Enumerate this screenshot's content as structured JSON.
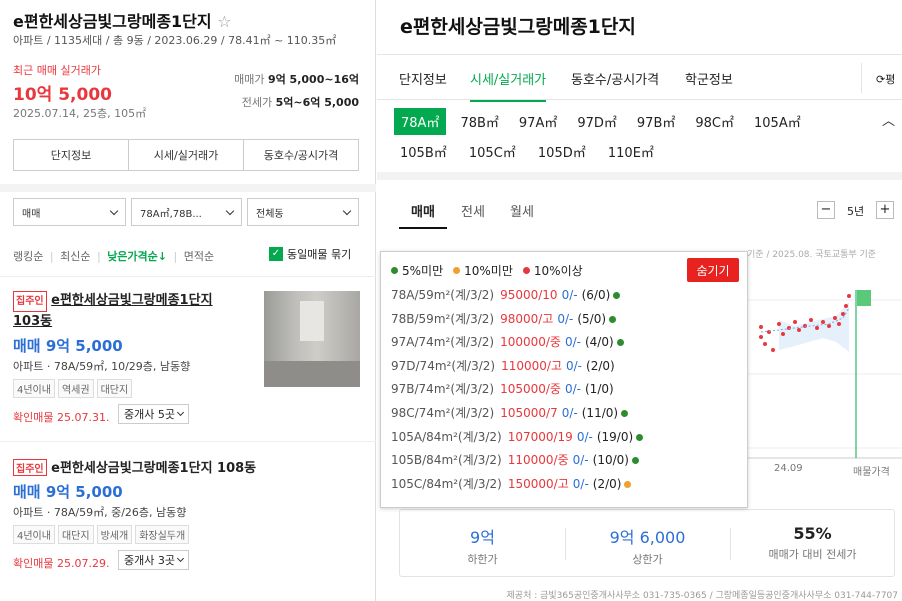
{
  "left": {
    "complex_name": "e편한세상금빛그랑메종1단지",
    "complex_info": "아파트 / 1135세대 / 총 9동 / 2023.06.29 / 78.41㎡ ~ 110.35㎡",
    "recent_label": "최근 매매 실거래가",
    "recent_price": "10억 5,000",
    "recent_date": "2025.07.14, 25층, 105㎡",
    "sale_label": "매매가",
    "sale_range": "9억 5,000~16억",
    "jeonse_label": "전세가",
    "jeonse_range": "5억~6억 5,000",
    "tabs": [
      "단지정보",
      "시세/실거래가",
      "동호수/공시가격"
    ],
    "filters": [
      "매매",
      "78A㎡,78B...",
      "전체동"
    ],
    "sort": [
      "랭킹순",
      "최신순",
      "낮은가격순↓",
      "면적순"
    ],
    "group_label": "동일매물 묶기",
    "listings": [
      {
        "badge": "집주인",
        "title": "e편한세상금빛그랑메종1단지 103동",
        "title_line1": "e편한세상금빛그랑메종1단지",
        "title_line2": "103동",
        "price": "매매 9억 5,000",
        "detail": "아파트 · 78A/59㎡, 10/29층, 남동향",
        "chips": [
          "4년이내",
          "역세권",
          "대단지"
        ],
        "confirm": "확인매물 25.07.31.",
        "agent": "중개사 5곳"
      },
      {
        "badge": "집주인",
        "title": "e편한세상금빛그랑메종1단지 108동",
        "price": "매매 9억 5,000",
        "detail": "아파트 · 78A/59㎡, 중/26층, 남동향",
        "chips": [
          "4년이내",
          "대단지",
          "방세개",
          "화장실두개"
        ],
        "confirm": "확인매물 25.07.29.",
        "agent": "중개사 3곳"
      }
    ]
  },
  "right": {
    "title": "e편한세상금빛그랑메종1단지",
    "tabs": [
      "단지정보",
      "시세/실거래가",
      "동호수/공시가격",
      "학군정보"
    ],
    "refresh_label": "평",
    "area_chips_row1": [
      "78A㎡",
      "78B㎡",
      "97A㎡",
      "97D㎡",
      "97B㎡",
      "98C㎡",
      "105A㎡"
    ],
    "area_chips_row2": [
      "105B㎡",
      "105C㎡",
      "105D㎡",
      "110E㎡"
    ],
    "deal_tabs": [
      "매매",
      "전세",
      "월세"
    ],
    "period": "5년",
    "source_partial": "기준 / 2025.08. 국토교통부 기준",
    "x_tick": "24.09",
    "x_end": "매물가격",
    "popup": {
      "legend": [
        "5%미만",
        "10%미만",
        "10%이상"
      ],
      "legend_colors": [
        "#2e8b2e",
        "#f0a030",
        "#e8383d"
      ],
      "hide_label": "숨기기",
      "rows": [
        {
          "type": "78A/59m²(계/3/2)",
          "price": "95000/10",
          "ratio": "0/-",
          "count": "(6/0)",
          "dot": "#2e8b2e"
        },
        {
          "type": "78B/59m²(계/3/2)",
          "price": "98000/고",
          "ratio": "0/-",
          "count": "(5/0)",
          "dot": "#2e8b2e"
        },
        {
          "type": "97A/74m²(계/3/2)",
          "price": "100000/중",
          "ratio": "0/-",
          "count": "(4/0)",
          "dot": "#2e8b2e"
        },
        {
          "type": "97D/74m²(계/3/2)",
          "price": "110000/고",
          "ratio": "0/-",
          "count": "(2/0)",
          "dot": ""
        },
        {
          "type": "97B/74m²(계/3/2)",
          "price": "105000/중",
          "ratio": "0/-",
          "count": "(1/0)",
          "dot": ""
        },
        {
          "type": "98C/74m²(계/3/2)",
          "price": "105000/7",
          "ratio": "0/-",
          "count": "(11/0)",
          "dot": "#2e8b2e"
        },
        {
          "type": "105A/84m²(계/3/2)",
          "price": "107000/19",
          "ratio": "0/-",
          "count": "(19/0)",
          "dot": "#2e8b2e"
        },
        {
          "type": "105B/84m²(계/3/2)",
          "price": "110000/중",
          "ratio": "0/-",
          "count": "(10/0)",
          "dot": "#2e8b2e"
        },
        {
          "type": "105C/84m²(계/3/2)",
          "price": "150000/고",
          "ratio": "0/-",
          "count": "(2/0)",
          "dot": "#f0a030"
        }
      ]
    },
    "summary": [
      {
        "value": "9억",
        "label": "하한가"
      },
      {
        "value": "9억 6,000",
        "label": "상한가"
      },
      {
        "value": "55%",
        "label": "매매가 대비 전세가"
      }
    ],
    "footer": "제공처 : 금빛365공인중개사사무소 031-735-0365 / 그랑메종일등공인중개사사무소 031-744-7707"
  },
  "colors": {
    "accent_green": "#03a94e",
    "price_blue": "#2b6fd6",
    "red": "#e8383d"
  }
}
